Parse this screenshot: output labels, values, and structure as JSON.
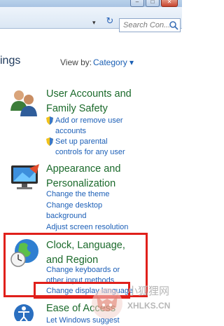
{
  "window": {
    "minimize_glyph": "–",
    "maximize_glyph": "□",
    "close_glyph": "✕"
  },
  "toolbar": {
    "dropdown_glyph": "▾",
    "refresh_glyph": "↻",
    "search_placeholder": "Search Con..."
  },
  "header": {
    "title_partial": "ings",
    "view_by_label": "View by:",
    "view_by_value": "Category ▾"
  },
  "categories": [
    {
      "title_line1": "User Accounts and",
      "title_line2": "Family Safety",
      "icon": "users-icon",
      "links": [
        {
          "text_line1": "Add or remove user",
          "text_line2": "accounts",
          "shield": true
        },
        {
          "text_line1": "Set up parental",
          "text_line2": "controls for any user",
          "shield": true
        }
      ]
    },
    {
      "title_line1": "Appearance and",
      "title_line2": "Personalization",
      "icon": "display-icon",
      "links": [
        {
          "text_line1": "Change the theme"
        },
        {
          "text_line1": "Change desktop",
          "text_line2": "background"
        },
        {
          "text_line1": "Adjust screen resolution"
        }
      ]
    },
    {
      "title_line1": "Clock, Language,",
      "title_line2": "and Region",
      "title_line3": "",
      "icon": "globe-clock-icon",
      "links": [
        {
          "text_line1": "Change keyboards or",
          "text_line2": "other input methods"
        },
        {
          "text_line1": "Change display language"
        }
      ]
    },
    {
      "title_line1": "Ease of Access",
      "icon": "ease-of-access-icon",
      "links": [
        {
          "text_line1": "Let Windows suggest"
        }
      ]
    }
  ],
  "watermark": {
    "text1": "小狐狸网",
    "text2": "XHLKS.CN"
  },
  "colors": {
    "highlight_box": "#e0201b",
    "category_title": "#1b6a2b",
    "link": "#1c5fb7"
  }
}
